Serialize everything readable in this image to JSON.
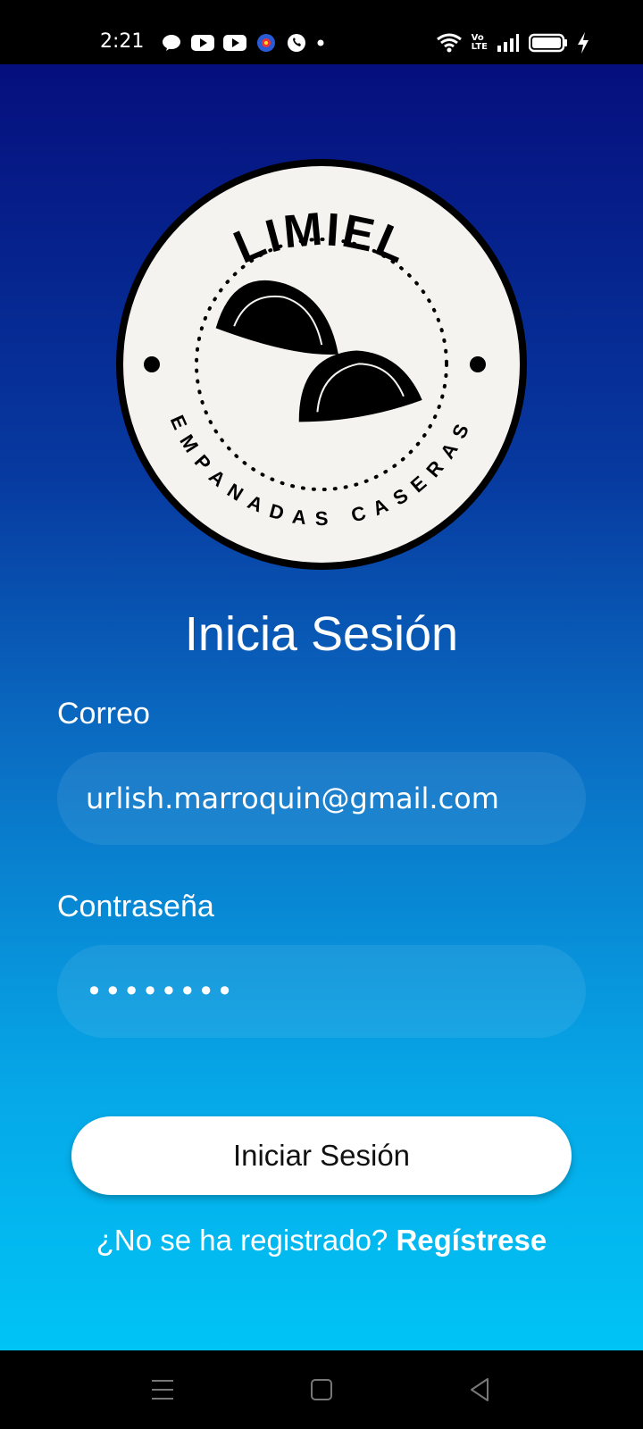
{
  "status_bar": {
    "time": "2:21",
    "left_icons": [
      "messenger-icon",
      "youtube-icon",
      "youtube-icon",
      "app-icon",
      "whatsapp-icon",
      "dot-icon"
    ],
    "right_icons": [
      "wifi-icon",
      "volte-icon",
      "signal-icon",
      "battery-icon",
      "charging-icon"
    ],
    "volte_text_top": "Vo",
    "volte_text_bottom": "LTE"
  },
  "logo": {
    "brand": "LIMIEL",
    "tagline": "EMPANADAS CASERAS"
  },
  "login": {
    "title": "Inicia Sesión",
    "email_label": "Correo",
    "email_value": "urlish.marroquin@gmail.com",
    "password_label": "Contraseña",
    "password_value": "••••••••",
    "submit_label": "Iniciar Sesión",
    "register_prompt": "¿No se ha registrado?",
    "register_link": "Regístrese"
  },
  "colors": {
    "gradient_top": "#050f7d",
    "gradient_bottom": "#00c4f5",
    "button_bg": "#ffffff",
    "logo_bg": "#f5f3ef"
  },
  "nav_bar": {
    "icons": [
      "menu-icon",
      "home-icon",
      "back-icon"
    ]
  }
}
